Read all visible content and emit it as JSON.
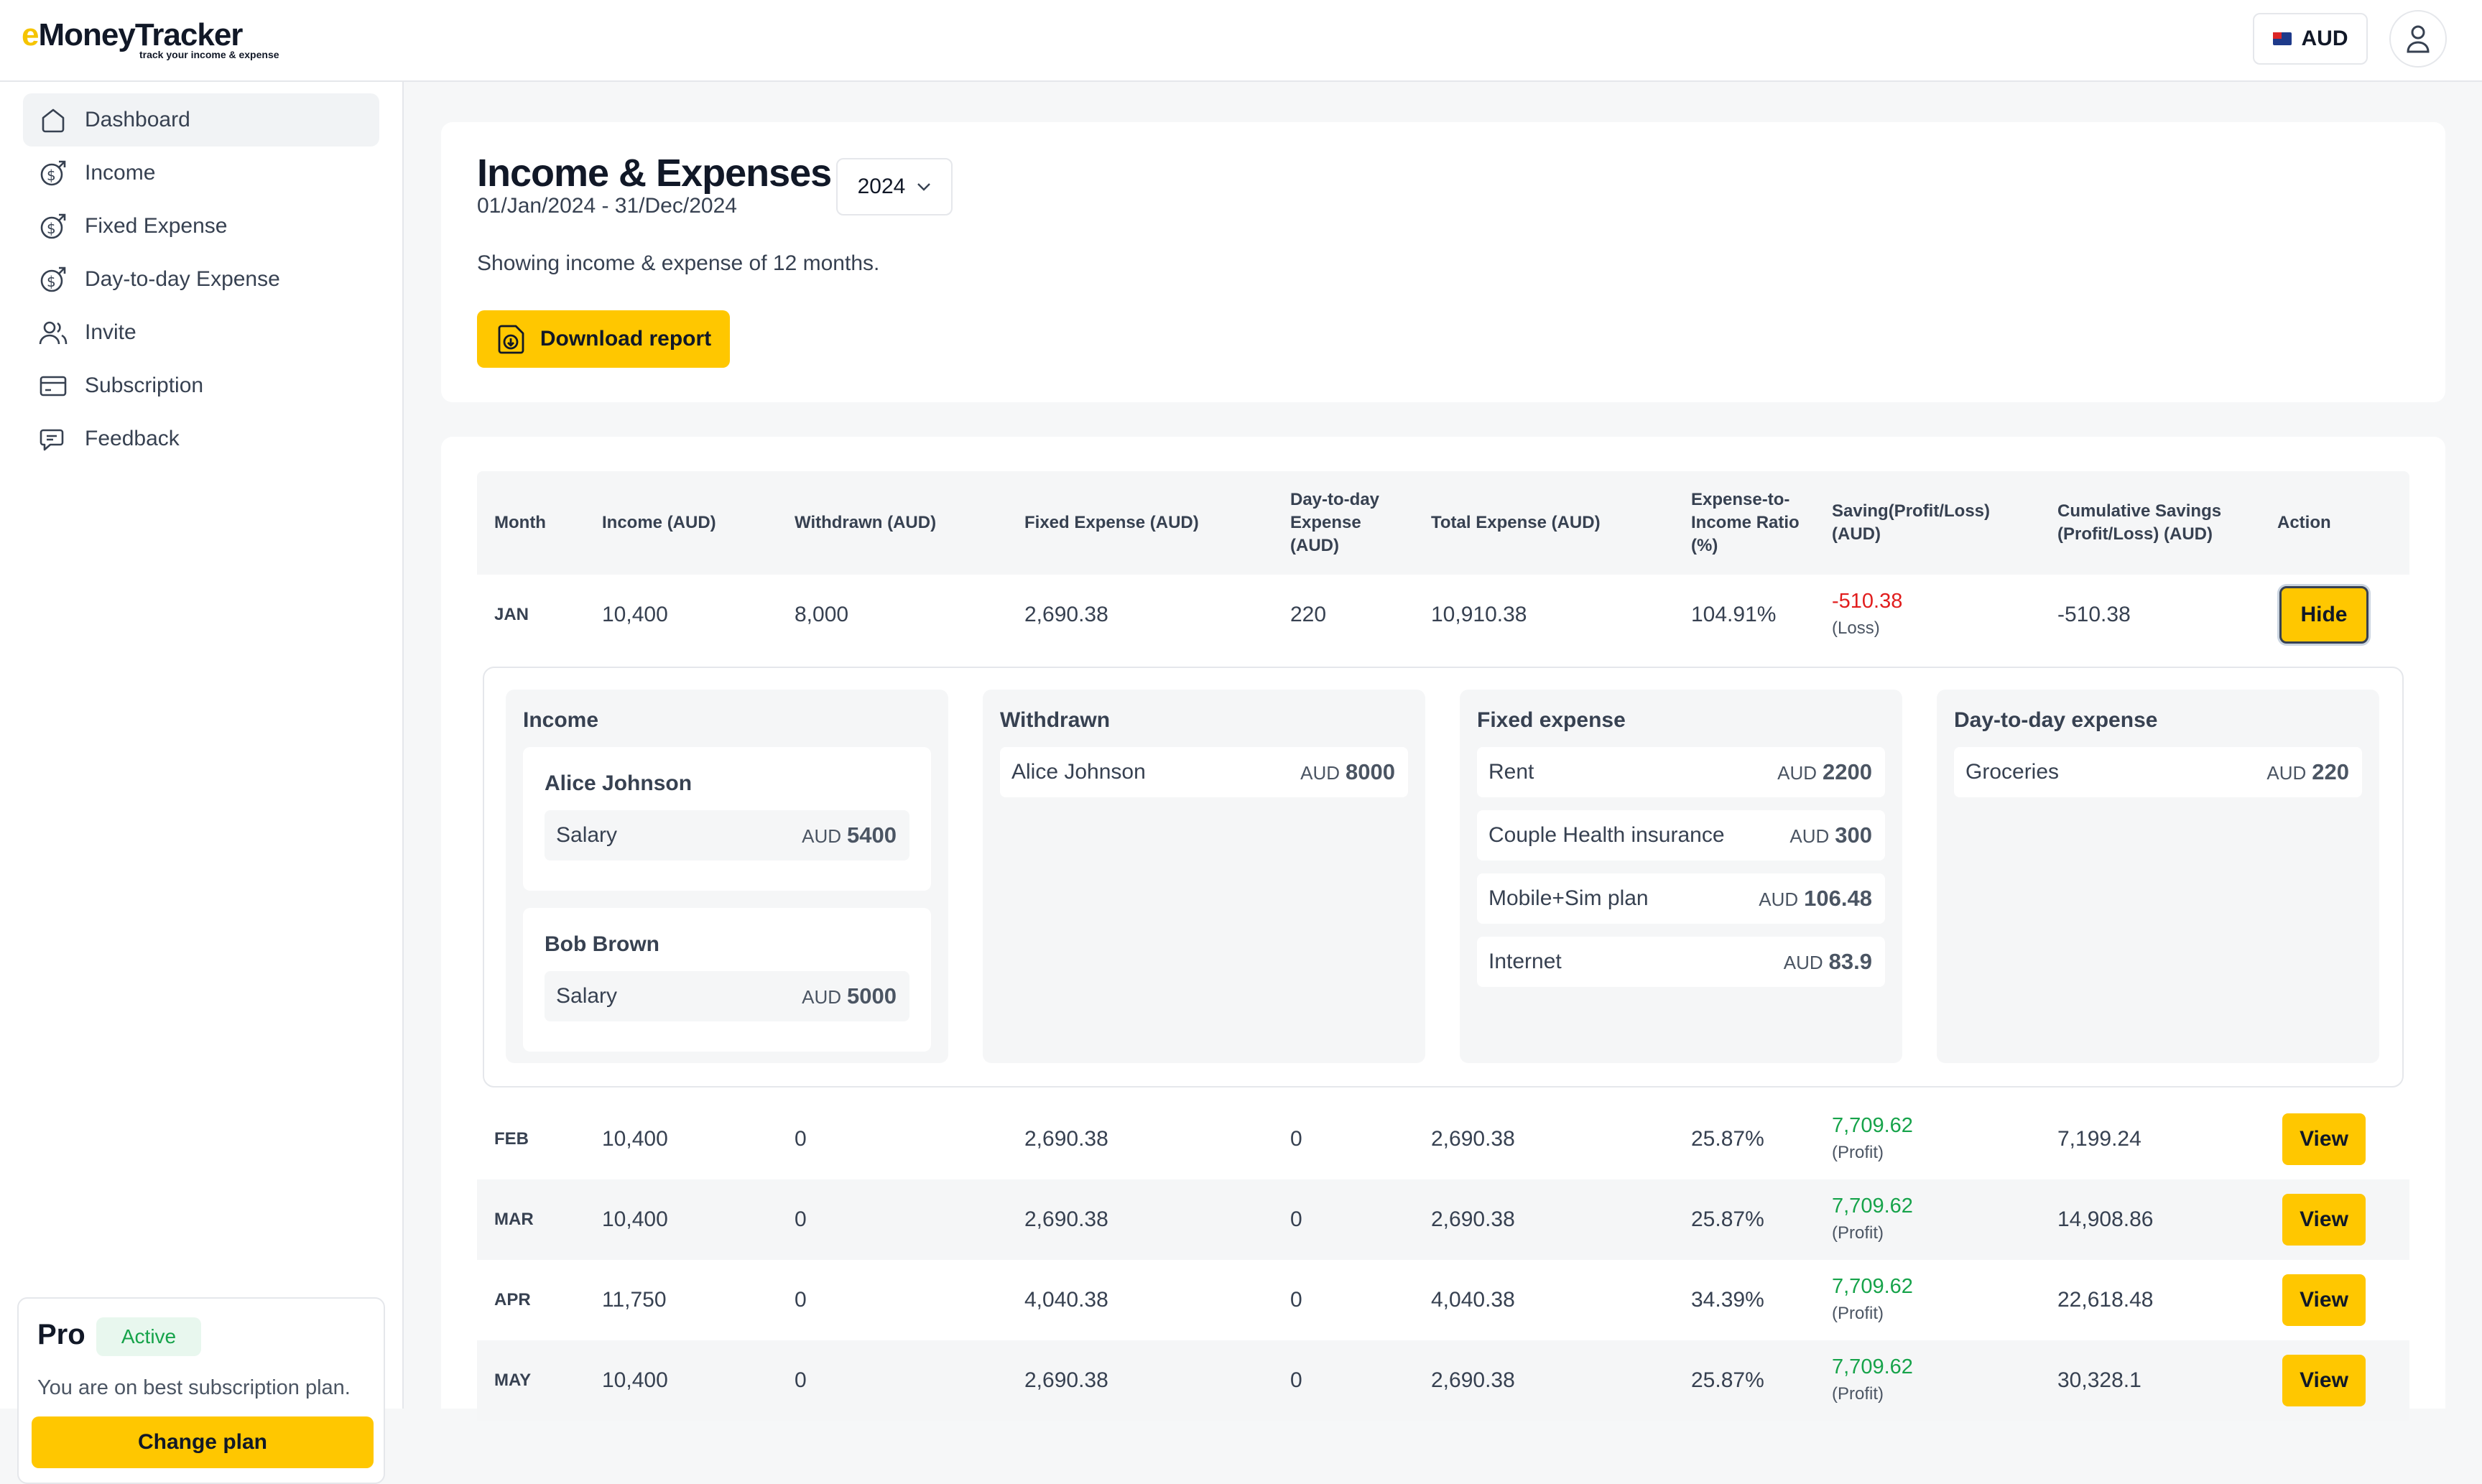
{
  "app": {
    "logo_e": "e",
    "logo_rest": "MoneyTracker",
    "tagline": "track your income & expense",
    "currency": "AUD"
  },
  "sidebar": {
    "items": [
      {
        "label": "Dashboard",
        "icon": "home-icon"
      },
      {
        "label": "Income",
        "icon": "income-icon"
      },
      {
        "label": "Fixed Expense",
        "icon": "fixed-expense-icon"
      },
      {
        "label": "Day-to-day Expense",
        "icon": "day-expense-icon"
      },
      {
        "label": "Invite",
        "icon": "invite-icon"
      },
      {
        "label": "Subscription",
        "icon": "card-icon"
      },
      {
        "label": "Feedback",
        "icon": "chat-icon"
      }
    ],
    "pro": {
      "title": "Pro",
      "badge": "Active",
      "description": "You are on best subscription plan.",
      "button": "Change plan"
    }
  },
  "header": {
    "title": "Income & Expenses",
    "date_range": "01/Jan/2024 - 31/Dec/2024",
    "year": "2024",
    "showing": "Showing income & expense of 12 months.",
    "download": "Download report"
  },
  "table": {
    "columns": [
      "Month",
      "Income (AUD)",
      "Withdrawn (AUD)",
      "Fixed Expense (AUD)",
      "Day-to-day Expense (AUD)",
      "Total Expense (AUD)",
      "Expense-to-Income Ratio (%)",
      "Saving(Profit/Loss) (AUD)",
      "Cumulative Savings (Profit/Loss) (AUD)",
      "Action"
    ],
    "expanded": {
      "month": "JAN",
      "income": "10,400",
      "withdrawn": "8,000",
      "fixed": "2,690.38",
      "daytoday": "220",
      "total": "10,910.38",
      "ratio": "104.91%",
      "saving": "-510.38",
      "saving_label": "(Loss)",
      "cumulative": "-510.38",
      "action": "Hide"
    },
    "rows": [
      {
        "month": "FEB",
        "income": "10,400",
        "withdrawn": "0",
        "fixed": "2,690.38",
        "daytoday": "0",
        "total": "2,690.38",
        "ratio": "25.87%",
        "saving": "7,709.62",
        "saving_label": "(Profit)",
        "cumulative": "7,199.24",
        "action": "View"
      },
      {
        "month": "MAR",
        "income": "10,400",
        "withdrawn": "0",
        "fixed": "2,690.38",
        "daytoday": "0",
        "total": "2,690.38",
        "ratio": "25.87%",
        "saving": "7,709.62",
        "saving_label": "(Profit)",
        "cumulative": "14,908.86",
        "action": "View"
      },
      {
        "month": "APR",
        "income": "11,750",
        "withdrawn": "0",
        "fixed": "4,040.38",
        "daytoday": "0",
        "total": "4,040.38",
        "ratio": "34.39%",
        "saving": "7,709.62",
        "saving_label": "(Profit)",
        "cumulative": "22,618.48",
        "action": "View"
      },
      {
        "month": "MAY",
        "income": "10,400",
        "withdrawn": "0",
        "fixed": "2,690.38",
        "daytoday": "0",
        "total": "2,690.38",
        "ratio": "25.87%",
        "saving": "7,709.62",
        "saving_label": "(Profit)",
        "cumulative": "30,328.1",
        "action": "View"
      }
    ]
  },
  "detail": {
    "income": {
      "title": "Income",
      "people": [
        {
          "name": "Alice Johnson",
          "item": "Salary",
          "currency": "AUD",
          "amount": "5400"
        },
        {
          "name": "Bob Brown",
          "item": "Salary",
          "currency": "AUD",
          "amount": "5000"
        }
      ]
    },
    "withdrawn": {
      "title": "Withdrawn",
      "items": [
        {
          "label": "Alice Johnson",
          "currency": "AUD",
          "amount": "8000"
        }
      ]
    },
    "fixed": {
      "title": "Fixed expense",
      "items": [
        {
          "label": "Rent",
          "currency": "AUD",
          "amount": "2200"
        },
        {
          "label": "Couple Health insurance",
          "currency": "AUD",
          "amount": "300"
        },
        {
          "label": "Mobile+Sim plan",
          "currency": "AUD",
          "amount": "106.48"
        },
        {
          "label": "Internet",
          "currency": "AUD",
          "amount": "83.9"
        }
      ]
    },
    "daytoday": {
      "title": "Day-to-day expense",
      "items": [
        {
          "label": "Groceries",
          "currency": "AUD",
          "amount": "220"
        }
      ]
    }
  },
  "colors": {
    "accent": "#ffc700",
    "loss": "#e11d1d",
    "profit": "#16a34a",
    "badge_bg": "#e8f7ee"
  }
}
